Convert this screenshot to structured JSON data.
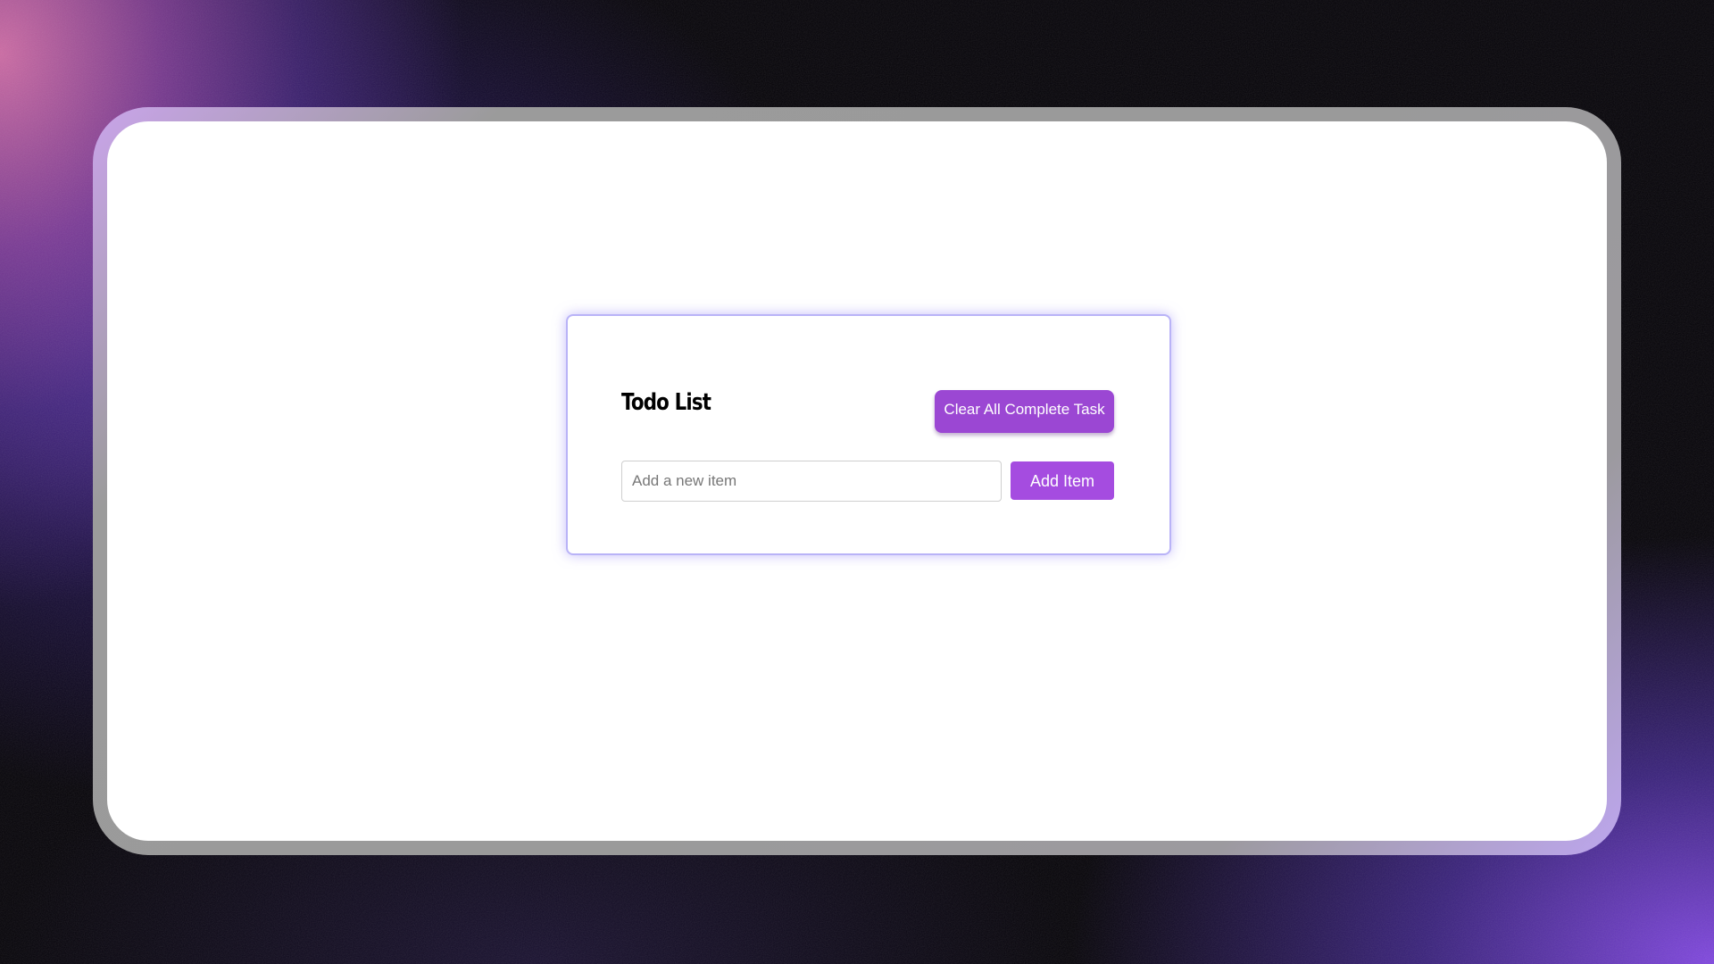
{
  "todo": {
    "title": "Todo List",
    "clear_button_label": "Clear All Complete Task",
    "input_placeholder": "Add a new item",
    "input_value": "",
    "add_button_label": "Add Item",
    "items": []
  },
  "colors": {
    "accent": "#a54ce0",
    "clear_button": "#9b47d3",
    "card_border": "#b9b3f7"
  }
}
